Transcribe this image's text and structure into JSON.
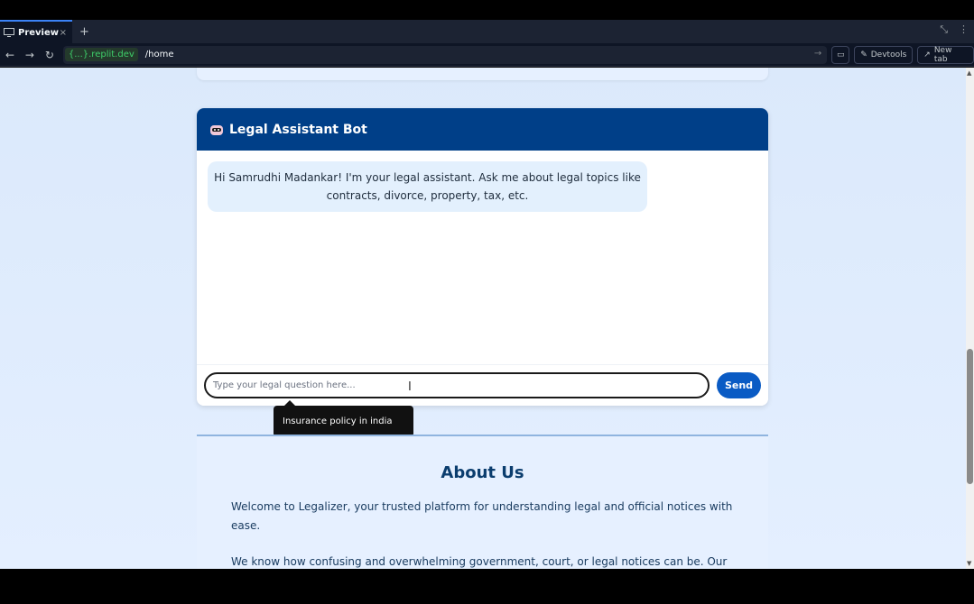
{
  "browser": {
    "tab_label": "Preview",
    "close_glyph": "×",
    "new_tab_glyph": "+",
    "domain": "{...}.replit.dev",
    "path": "/home",
    "devtools_label": "Devtools",
    "newtab_label": "New tab"
  },
  "chat": {
    "title": "Legal Assistant Bot",
    "greeting": "Hi Samrudhi Madankar! I'm your legal assistant. Ask me about legal topics like contracts, divorce, property, tax, etc.",
    "input_placeholder": "Type your legal question here...",
    "send_label": "Send"
  },
  "tooltip": {
    "text": "Insurance policy in india"
  },
  "about": {
    "heading": "About Us",
    "paragraph1": "Welcome to Legalizer, your trusted platform for understanding legal and official notices with ease.",
    "paragraph2": "We know how confusing and overwhelming government, court, or legal notices can be. Our mission is to bridge the gap between official language and public understanding. Whether it's a"
  },
  "colors": {
    "header_bg": "#003f88",
    "send_bg": "#0a5bc4",
    "page_bg": "#dbe9fb"
  }
}
